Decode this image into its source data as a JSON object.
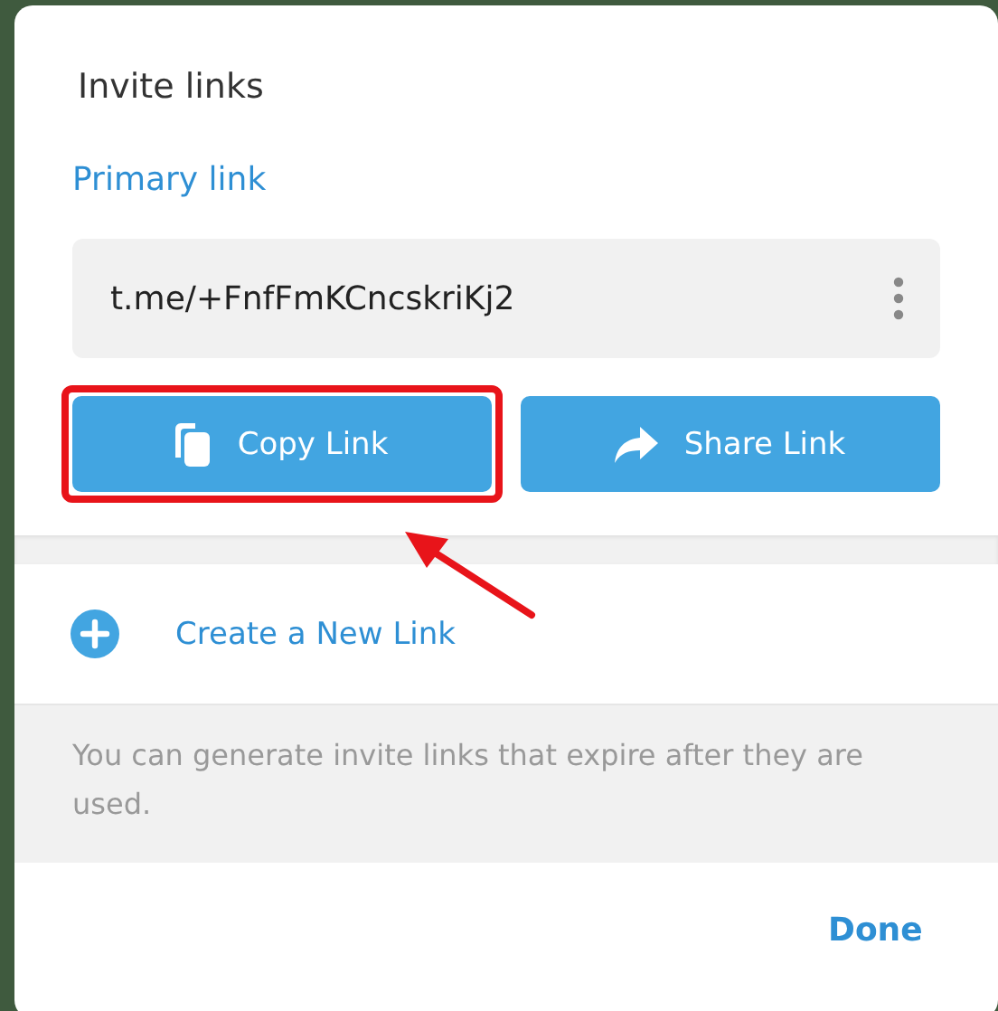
{
  "dialog": {
    "title": "Invite links",
    "section_title": "Primary link",
    "link": "t.me/+FnfFmKCncskriKj2",
    "buttons": [
      {
        "kind": "copy",
        "label": "Copy Link",
        "highlighted": true
      },
      {
        "kind": "share",
        "label": "Share Link",
        "highlighted": false
      }
    ],
    "create_link": "Create a New Link",
    "note": "You can generate invite links that expire after they are used.",
    "done": "Done"
  }
}
